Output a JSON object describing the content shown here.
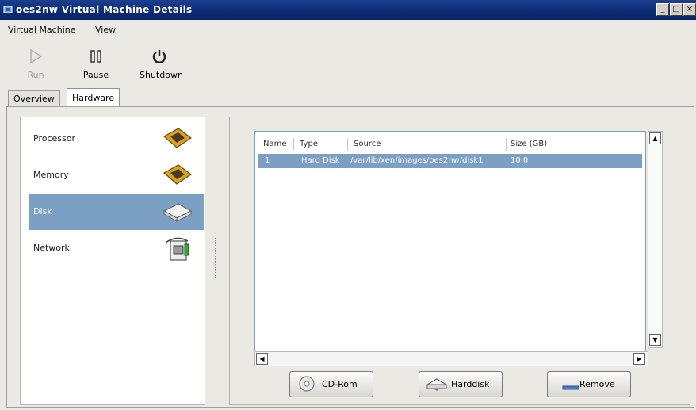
{
  "window": {
    "title": "oes2nw Virtual Machine Details",
    "controls": [
      "_",
      "□",
      "×"
    ]
  },
  "menubar": {
    "items": [
      "Virtual Machine",
      "View"
    ]
  },
  "toolbar": {
    "run_label": "Run",
    "pause_label": "Pause",
    "shutdown_label": "Shutdown"
  },
  "tabs": [
    "Overview",
    "Hardware"
  ],
  "active_tab": "Hardware",
  "hardware": {
    "items": [
      {
        "label": "Processor",
        "icon": "processor-icon"
      },
      {
        "label": "Memory",
        "icon": "memory-icon"
      },
      {
        "label": "Disk",
        "icon": "disk-icon"
      },
      {
        "label": "Network",
        "icon": "network-icon"
      }
    ],
    "selected": "Disk"
  },
  "disk_table": {
    "columns": [
      "Name",
      "Type",
      "Source",
      "Size (GB)"
    ],
    "rows": [
      {
        "name": "1",
        "type": "Hard Disk",
        "source": "/var/lib/xen/images/oes2nw/disk1",
        "size": "10.0"
      }
    ]
  },
  "buttons": {
    "cdrom_label": "CD-Rom",
    "harddisk_label": "Harddisk",
    "remove_label": "Remove"
  },
  "colors": {
    "selection": "#7c9fc4",
    "titlebar": "#0b2a72"
  }
}
